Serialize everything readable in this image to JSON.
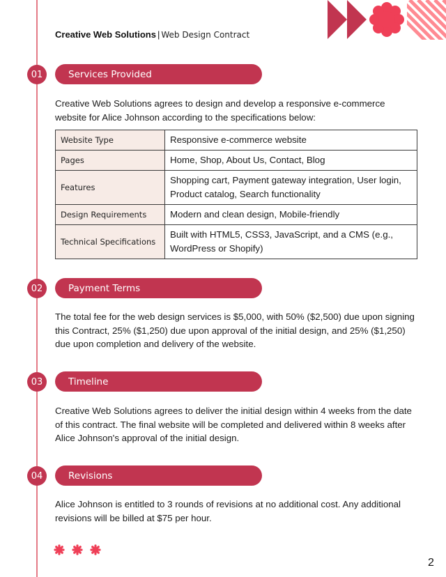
{
  "header": {
    "company": "Creative Web Solutions",
    "separator": "|",
    "document_title": "Web Design Contract"
  },
  "colors": {
    "accent": "#c13550",
    "accent_bright": "#ef3f57",
    "stripe": "#ff8a92",
    "table_key_bg": "#f7ebe6",
    "timeline_line": "#e47a86"
  },
  "decorations": {
    "top_right": [
      "double-triangle-arrow-icon",
      "flower-icon",
      "diagonal-stripes"
    ],
    "footer": [
      "asterisk-icon",
      "asterisk-icon",
      "asterisk-icon"
    ]
  },
  "sections": [
    {
      "number": "01",
      "title": "Services Provided",
      "intro": "Creative Web Solutions agrees to design and develop a responsive e-commerce website for Alice Johnson according to the specifications below:",
      "table": [
        {
          "key": "Website Type",
          "value": "Responsive e-commerce website"
        },
        {
          "key": "Pages",
          "value": "Home, Shop, About Us, Contact, Blog"
        },
        {
          "key": "Features",
          "value": "Shopping cart, Payment gateway integration, User login, Product catalog, Search functionality"
        },
        {
          "key": "Design Requirements",
          "value": "Modern and clean design, Mobile-friendly"
        },
        {
          "key": "Technical Specifications",
          "value": "Built with HTML5, CSS3, JavaScript, and a CMS (e.g., WordPress or Shopify)"
        }
      ]
    },
    {
      "number": "02",
      "title": "Payment Terms",
      "body": "The total fee for the web design services is $5,000, with 50% ($2,500) due upon signing this Contract, 25% ($1,250) due upon approval of the initial design, and 25% ($1,250) due upon completion and delivery of the website."
    },
    {
      "number": "03",
      "title": "Timeline",
      "body": "Creative Web Solutions agrees to deliver the initial design within 4 weeks from the date of this contract. The final website will be completed and delivered within 8 weeks after Alice Johnson's approval of the initial design."
    },
    {
      "number": "04",
      "title": "Revisions",
      "body": "Alice Johnson is entitled to 3 rounds of revisions at no additional cost. Any additional revisions will be billed at $75 per hour."
    }
  ],
  "page_number": "2"
}
